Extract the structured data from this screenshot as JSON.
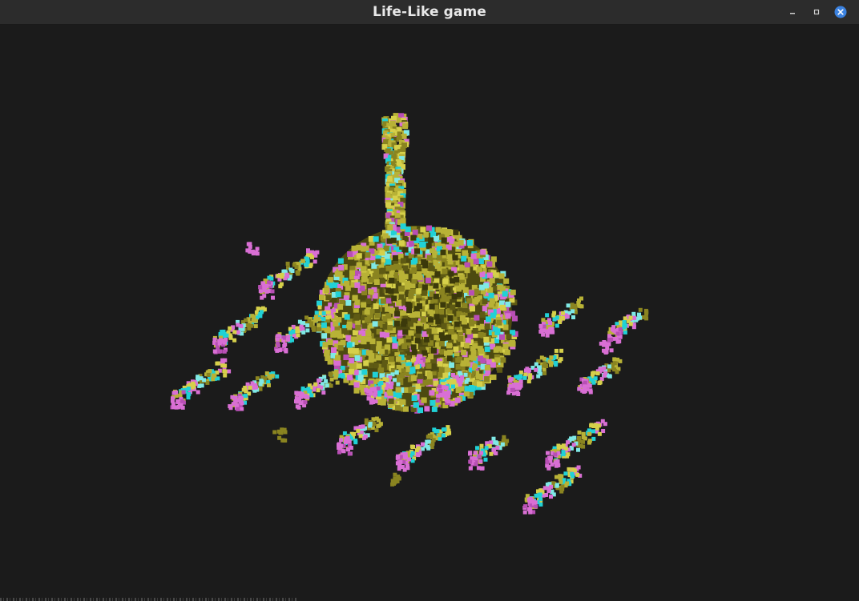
{
  "window": {
    "title": "Life-Like game",
    "controls": [
      {
        "name": "minimize",
        "icon": "minimize-icon"
      },
      {
        "name": "maximize",
        "icon": "maximize-icon"
      },
      {
        "name": "close",
        "icon": "close-icon"
      }
    ]
  },
  "scene": {
    "background": "#1b1b1b",
    "cell_colors": [
      "#b8b236",
      "#8a8420",
      "#d6d04a",
      "#5e5a14",
      "#d96fd4",
      "#b84fb5",
      "#21d1d6",
      "#7fe9e6"
    ],
    "structures": [
      "central-sphere",
      "vertical-tower",
      "glider-array"
    ]
  },
  "accents": {
    "close_button": "#3b82e0"
  }
}
